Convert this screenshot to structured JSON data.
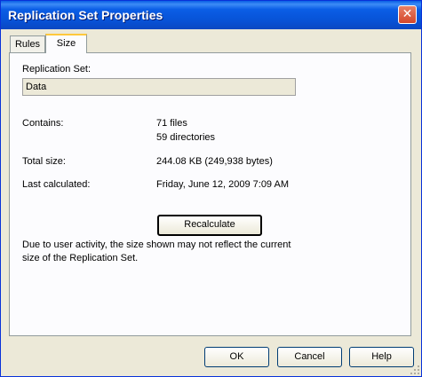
{
  "window": {
    "title": "Replication Set Properties",
    "close_glyph": "✕"
  },
  "tabs": [
    {
      "label": "Rules"
    },
    {
      "label": "Size"
    }
  ],
  "size_tab": {
    "replication_set_label": "Replication Set:",
    "replication_set_value": "Data",
    "contains_label": "Contains:",
    "files": "71 files",
    "directories": "59 directories",
    "total_size_label": "Total size:",
    "total_size_value": "244.08 KB (249,938 bytes)",
    "last_calculated_label": "Last calculated:",
    "last_calculated_value": "Friday, June 12, 2009 7:09 AM",
    "recalculate_label": "Recalculate",
    "note_line1": "Due to user activity, the size shown may not reflect the current",
    "note_line2": "size of the Replication Set."
  },
  "footer": {
    "ok_label": "OK",
    "cancel_label": "Cancel",
    "help_label": "Help"
  }
}
